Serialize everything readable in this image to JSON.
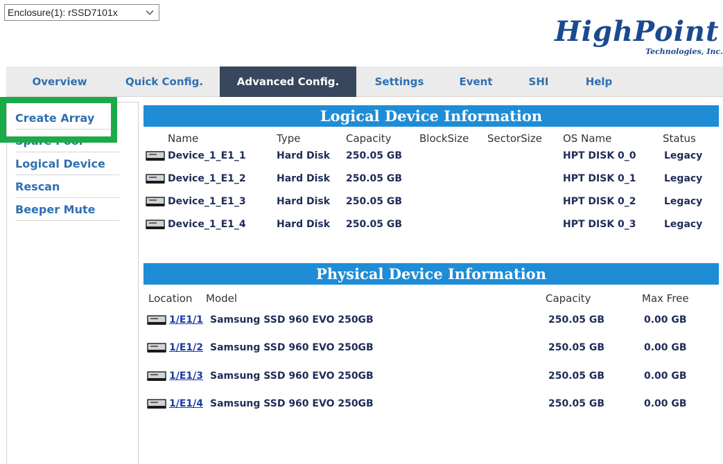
{
  "enclosure": {
    "value": "Enclosure(1): rSSD7101x"
  },
  "logo": {
    "brand": "HighPoint",
    "sub": "Technologies, Inc."
  },
  "tabs": [
    {
      "label": "Overview"
    },
    {
      "label": "Quick Config."
    },
    {
      "label": "Advanced Config."
    },
    {
      "label": "Settings"
    },
    {
      "label": "Event"
    },
    {
      "label": "SHI"
    },
    {
      "label": "Help"
    }
  ],
  "sidebar": {
    "items": [
      {
        "label": "Create Array"
      },
      {
        "label": "Spare Pool"
      },
      {
        "label": "Logical Device"
      },
      {
        "label": "Rescan"
      },
      {
        "label": "Beeper Mute"
      }
    ]
  },
  "logical": {
    "title": "Logical Device Information",
    "headers": {
      "name": "Name",
      "type": "Type",
      "capacity": "Capacity",
      "blocksize": "BlockSize",
      "sectorsize": "SectorSize",
      "osname": "OS Name",
      "status": "Status"
    },
    "rows": [
      {
        "name": "Device_1_E1_1",
        "type": "Hard Disk",
        "capacity": "250.05 GB",
        "osname": "HPT DISK 0_0",
        "status": "Legacy"
      },
      {
        "name": "Device_1_E1_2",
        "type": "Hard Disk",
        "capacity": "250.05 GB",
        "osname": "HPT DISK 0_1",
        "status": "Legacy"
      },
      {
        "name": "Device_1_E1_3",
        "type": "Hard Disk",
        "capacity": "250.05 GB",
        "osname": "HPT DISK 0_2",
        "status": "Legacy"
      },
      {
        "name": "Device_1_E1_4",
        "type": "Hard Disk",
        "capacity": "250.05 GB",
        "osname": "HPT DISK 0_3",
        "status": "Legacy"
      }
    ]
  },
  "physical": {
    "title": "Physical Device Information",
    "headers": {
      "location": "Location",
      "model": "Model",
      "capacity": "Capacity",
      "maxfree": "Max Free"
    },
    "rows": [
      {
        "location": "1/E1/1",
        "model": "Samsung SSD 960 EVO 250GB",
        "capacity": "250.05 GB",
        "maxfree": "0.00 GB"
      },
      {
        "location": "1/E1/2",
        "model": "Samsung SSD 960 EVO 250GB",
        "capacity": "250.05 GB",
        "maxfree": "0.00 GB"
      },
      {
        "location": "1/E1/3",
        "model": "Samsung SSD 960 EVO 250GB",
        "capacity": "250.05 GB",
        "maxfree": "0.00 GB"
      },
      {
        "location": "1/E1/4",
        "model": "Samsung SSD 960 EVO 250GB",
        "capacity": "250.05 GB",
        "maxfree": "0.00 GB"
      }
    ]
  },
  "colors": {
    "banner": "#1e8dd6",
    "tab_active": "#37475d",
    "link": "#2f6fb0",
    "highlight": "#1aaa48"
  }
}
